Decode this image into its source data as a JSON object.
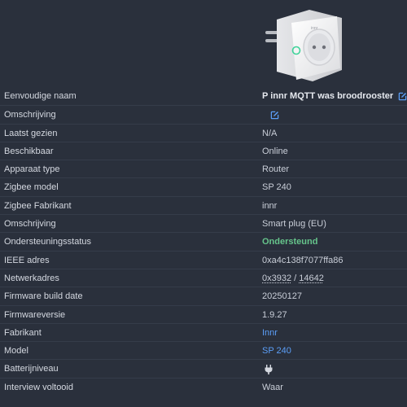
{
  "device": {
    "image_icon": "smart-plug-image",
    "brand_text": "innr"
  },
  "rows": [
    {
      "key": "friendly_name",
      "label": "Eenvoudige naam",
      "value": "P innr MQTT was broodrooster",
      "icon": "edit-icon"
    },
    {
      "key": "description_edit",
      "label": "Omschrijving",
      "value": "",
      "icon": "edit-icon"
    },
    {
      "key": "last_seen",
      "label": "Laatst gezien",
      "value": "N/A"
    },
    {
      "key": "availability",
      "label": "Beschikbaar",
      "value": "Online"
    },
    {
      "key": "device_type",
      "label": "Apparaat type",
      "value": "Router"
    },
    {
      "key": "zigbee_model",
      "label": "Zigbee model",
      "value": "SP 240"
    },
    {
      "key": "zigbee_manufacturer",
      "label": "Zigbee Fabrikant",
      "value": "innr"
    },
    {
      "key": "description",
      "label": "Omschrijving",
      "value": "Smart plug (EU)"
    },
    {
      "key": "support_status",
      "label": "Ondersteuningsstatus",
      "value": "Ondersteund"
    },
    {
      "key": "ieee_address",
      "label": "IEEE adres",
      "value": "0xa4c138f7077ffa86"
    },
    {
      "key": "network_address",
      "label": "Netwerkadres",
      "value_hex": "0x3932",
      "separator": " / ",
      "value_dec": "14642"
    },
    {
      "key": "firmware_build_date",
      "label": "Firmware build date",
      "value": "20250127"
    },
    {
      "key": "firmware_version",
      "label": "Firmwareversie",
      "value": "1.9.27"
    },
    {
      "key": "manufacturer",
      "label": "Fabrikant",
      "value": "Innr"
    },
    {
      "key": "model",
      "label": "Model",
      "value": "SP 240"
    },
    {
      "key": "battery",
      "label": "Batterijniveau",
      "value": "",
      "icon": "power-plug-icon"
    },
    {
      "key": "interview",
      "label": "Interview voltooid",
      "value": "Waar"
    }
  ],
  "colors": {
    "background": "#2a303c",
    "link": "#5b9ef7",
    "supported": "#66c48b"
  }
}
